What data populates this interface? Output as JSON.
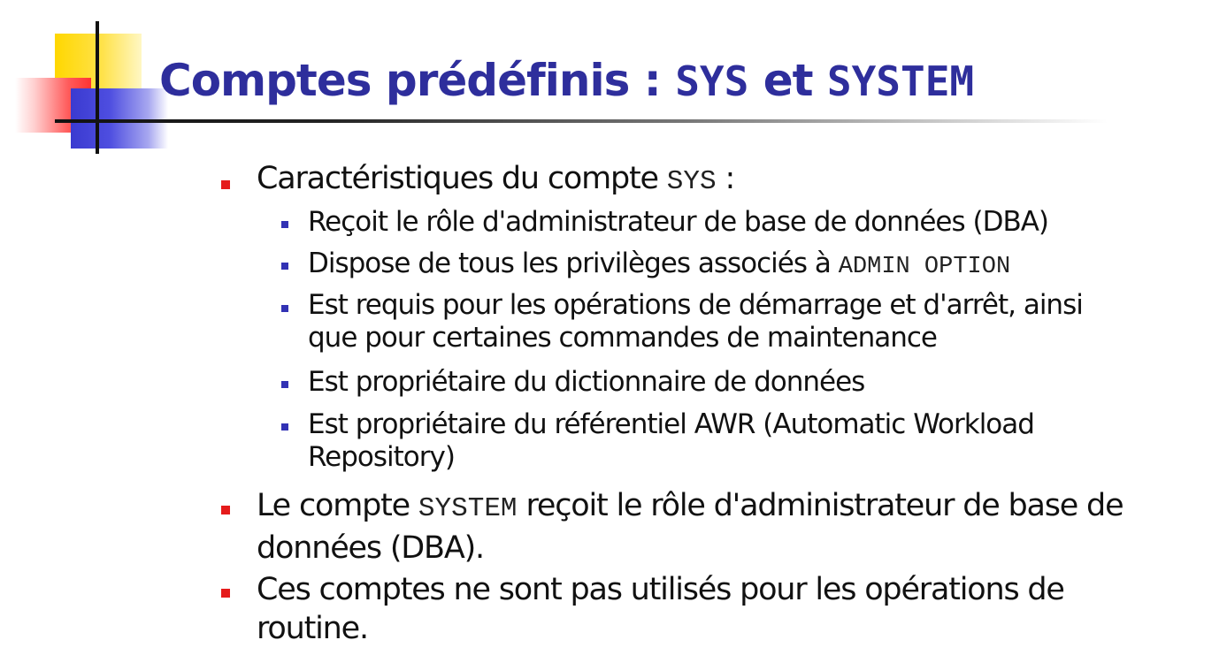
{
  "slide": {
    "title": {
      "part1": "Comptes prédéfinis : ",
      "code1": "SYS",
      "part2": " et ",
      "code2": "SYSTEM"
    },
    "bullets": [
      {
        "text": "Caractéristiques du compte ",
        "code": "SYS",
        "suffix": " :"
      },
      {
        "text": "Reçoit le rôle d'administrateur de base de données (DBA)"
      },
      {
        "text": "Dispose de tous les privilèges associés à ",
        "code": "ADMIN OPTION"
      },
      {
        "text": "Est requis pour les opérations de démarrage et d'arrêt, ainsi que pour certaines commandes de maintenance"
      },
      {
        "text": "Est propriétaire du dictionnaire de données"
      },
      {
        "text": "Est propriétaire du référentiel AWR (Automatic Workload Repository)"
      },
      {
        "prefix": "Le compte ",
        "code": "SYSTEM",
        "text": " reçoit le rôle d'administrateur de base de données (DBA)."
      },
      {
        "text": "Ces comptes ne sont pas utilisés pour les opérations de routine."
      }
    ]
  },
  "colors": {
    "title": "#2e2e9c",
    "bullet_level1": "#e51b1b",
    "bullet_level2": "#3232b4"
  }
}
